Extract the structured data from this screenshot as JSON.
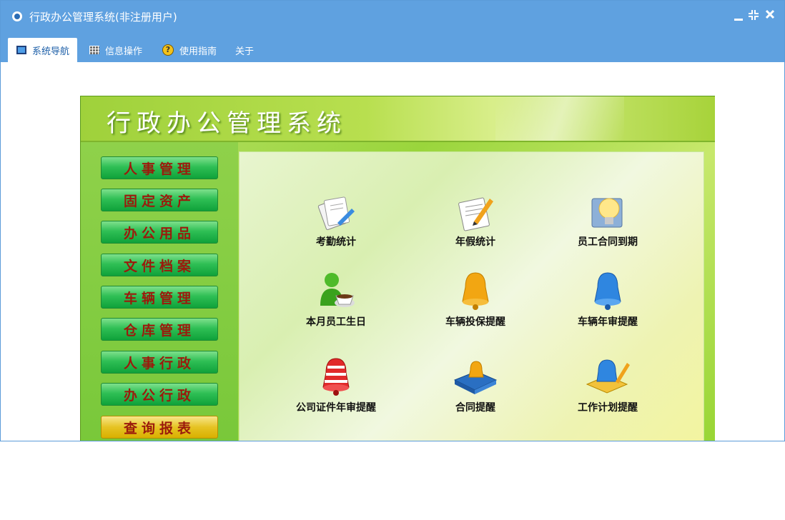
{
  "window": {
    "title": "行政办公管理系统(非注册用户)"
  },
  "menu": {
    "tabs": [
      {
        "label": "系统导航",
        "icon": "monitor-icon"
      },
      {
        "label": "信息操作",
        "icon": "grid-icon"
      },
      {
        "label": "使用指南",
        "icon": "help-icon"
      },
      {
        "label": "关于"
      }
    ]
  },
  "app": {
    "title": "行政办公管理系统",
    "sidebar": [
      {
        "label": "人事管理"
      },
      {
        "label": "固定资产"
      },
      {
        "label": "办公用品"
      },
      {
        "label": "文件档案"
      },
      {
        "label": "车辆管理"
      },
      {
        "label": "仓库管理"
      },
      {
        "label": "人事行政"
      },
      {
        "label": "办公行政"
      },
      {
        "label": "查询报表"
      }
    ],
    "tiles": [
      {
        "label": "考勤统计",
        "icon": "attendance-icon"
      },
      {
        "label": "年假统计",
        "icon": "annual-leave-icon"
      },
      {
        "label": "员工合同到期",
        "icon": "contract-expiry-icon"
      },
      {
        "label": "本月员工生日",
        "icon": "birthday-icon"
      },
      {
        "label": "车辆投保提醒",
        "icon": "insurance-bell-icon"
      },
      {
        "label": "车辆年审提醒",
        "icon": "inspection-bell-icon"
      },
      {
        "label": "公司证件年审提醒",
        "icon": "certificate-bell-icon"
      },
      {
        "label": "合同提醒",
        "icon": "contract-bell-icon"
      },
      {
        "label": "工作计划提醒",
        "icon": "work-plan-icon"
      }
    ]
  },
  "colors": {
    "titlebar": "#5fa1e0",
    "accent_text": "#9b1a0c",
    "active_button": "#e6c323"
  }
}
